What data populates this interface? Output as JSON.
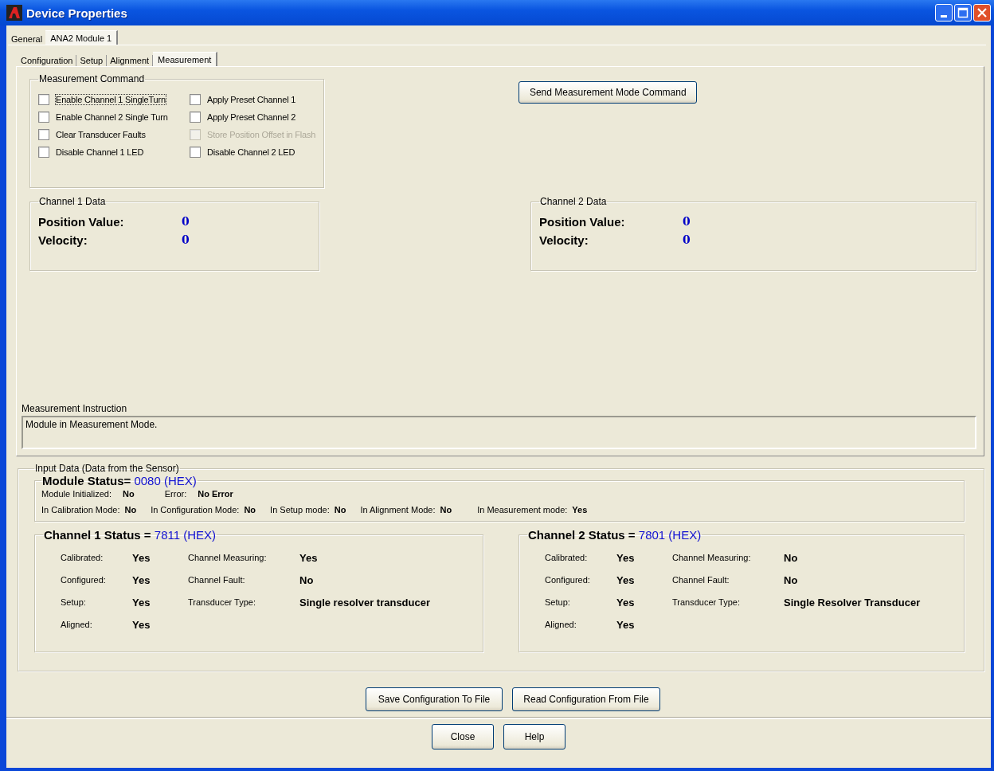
{
  "window": {
    "title": "Device Properties"
  },
  "outer_tabs": [
    {
      "label": "General",
      "selected": false
    },
    {
      "label": "ANA2 Module 1",
      "selected": true
    }
  ],
  "inner_tabs": [
    {
      "label": "Configuration",
      "selected": false
    },
    {
      "label": "Setup",
      "selected": false
    },
    {
      "label": "Alignment",
      "selected": false
    },
    {
      "label": "Measurement",
      "selected": true
    }
  ],
  "measurement_command": {
    "title": "Measurement Command",
    "checkboxes": [
      {
        "label": "Enable Channel 1 SingleTurn",
        "checked": false,
        "disabled": false,
        "focused": true
      },
      {
        "label": "Apply Preset Channel 1",
        "checked": false,
        "disabled": false,
        "focused": false
      },
      {
        "label": "Enable Channel 2 Single Turn",
        "checked": false,
        "disabled": false,
        "focused": false
      },
      {
        "label": "Apply Preset Channel 2",
        "checked": false,
        "disabled": false,
        "focused": false
      },
      {
        "label": "Clear Transducer Faults",
        "checked": false,
        "disabled": false,
        "focused": false
      },
      {
        "label": "Store Position Offset in Flash",
        "checked": false,
        "disabled": true,
        "focused": false
      },
      {
        "label": "Disable Channel 1 LED",
        "checked": false,
        "disabled": false,
        "focused": false
      },
      {
        "label": "Disable Channel 2 LED",
        "checked": false,
        "disabled": false,
        "focused": false
      }
    ]
  },
  "send_button": "Send Measurement Mode Command",
  "channel_data": [
    {
      "title": "Channel 1 Data",
      "rows": [
        {
          "label": "Position Value:",
          "value": "0"
        },
        {
          "label": "Velocity:",
          "value": "0"
        }
      ]
    },
    {
      "title": "Channel 2 Data",
      "rows": [
        {
          "label": "Position Value:",
          "value": "0"
        },
        {
          "label": "Velocity:",
          "value": "0"
        }
      ]
    }
  ],
  "instruction": {
    "label": "Measurement Instruction",
    "text": "Module in Measurement Mode."
  },
  "input_data": {
    "title": "Input Data (Data from the Sensor)",
    "module_status": {
      "title": "Module Status=",
      "value": "0080 (HEX)",
      "rows": [
        [
          {
            "label": "Module Initialized:",
            "value": "No"
          },
          {
            "label": "Error:",
            "value": "No Error"
          }
        ],
        [
          {
            "label": "In Calibration Mode:",
            "value": "No"
          },
          {
            "label": "In Configuration Mode:",
            "value": "No"
          },
          {
            "label": "In Setup mode:",
            "value": "No"
          },
          {
            "label": "In Alignment Mode:",
            "value": "No"
          },
          {
            "label": "In Measurement mode:",
            "value": "Yes"
          }
        ]
      ]
    },
    "channels": [
      {
        "title": "Channel 1 Status =",
        "value": "7811 (HEX)",
        "left": [
          {
            "label": "Calibrated:",
            "value": "Yes"
          },
          {
            "label": "Configured:",
            "value": "Yes"
          },
          {
            "label": "Setup:",
            "value": "Yes"
          },
          {
            "label": "Aligned:",
            "value": "Yes"
          }
        ],
        "right": [
          {
            "label": "Channel Measuring:",
            "value": "Yes"
          },
          {
            "label": "Channel Fault:",
            "value": "No"
          },
          {
            "label": "Transducer Type:",
            "value": "Single resolver transducer"
          }
        ]
      },
      {
        "title": "Channel 2 Status =",
        "value": "7801 (HEX)",
        "left": [
          {
            "label": "Calibrated:",
            "value": "Yes"
          },
          {
            "label": "Configured:",
            "value": "Yes"
          },
          {
            "label": "Setup:",
            "value": "Yes"
          },
          {
            "label": "Aligned:",
            "value": "Yes"
          }
        ],
        "right": [
          {
            "label": "Channel Measuring:",
            "value": "No"
          },
          {
            "label": "Channel Fault:",
            "value": "No"
          },
          {
            "label": "Transducer Type:",
            "value": "Single Resolver Transducer"
          }
        ]
      }
    ]
  },
  "file_buttons": [
    "Save Configuration To File",
    "Read Configuration From File"
  ],
  "dialog_buttons": [
    "Close",
    "Help"
  ]
}
